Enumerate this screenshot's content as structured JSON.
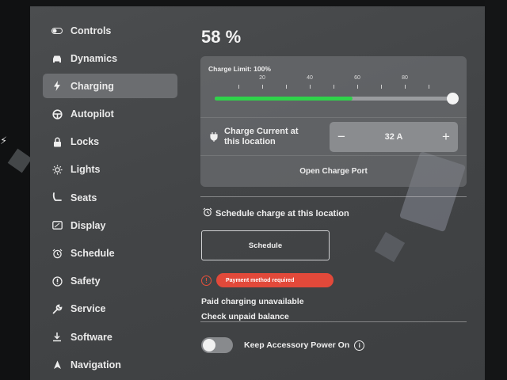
{
  "sidebar": {
    "items": [
      {
        "label": "Controls",
        "icon": "toggle-icon"
      },
      {
        "label": "Dynamics",
        "icon": "car-icon"
      },
      {
        "label": "Charging",
        "icon": "bolt-icon",
        "active": true
      },
      {
        "label": "Autopilot",
        "icon": "steering-wheel-icon"
      },
      {
        "label": "Locks",
        "icon": "lock-icon"
      },
      {
        "label": "Lights",
        "icon": "sun-icon"
      },
      {
        "label": "Seats",
        "icon": "seat-icon"
      },
      {
        "label": "Display",
        "icon": "display-icon"
      },
      {
        "label": "Schedule",
        "icon": "alarm-clock-icon"
      },
      {
        "label": "Safety",
        "icon": "info-circle-icon"
      },
      {
        "label": "Service",
        "icon": "wrench-icon"
      },
      {
        "label": "Software",
        "icon": "download-icon"
      },
      {
        "label": "Navigation",
        "icon": "navigation-arrow-icon"
      }
    ]
  },
  "charging": {
    "battery_percent": "58 %",
    "limit_label": "Charge Limit: 100%",
    "limit_value_percent": 100,
    "battery_level_fraction": 0.58,
    "tick_labels": [
      "20",
      "40",
      "60",
      "80"
    ],
    "current_label": "Charge Current at this location",
    "current_value": "32 A",
    "minus_symbol": "−",
    "plus_symbol": "+",
    "open_port_label": "Open Charge Port"
  },
  "schedule": {
    "title": "Schedule charge at this location",
    "button_label": "Schedule"
  },
  "payment": {
    "warning_symbol": "!",
    "badge_text": "Payment method required",
    "paid_unavailable": "Paid charging unavailable",
    "unpaid_link": "Check unpaid balance"
  },
  "accessory": {
    "label": "Keep Accessory Power On",
    "info_symbol": "i",
    "enabled": false
  },
  "colors": {
    "accent_green": "#2fd34a",
    "warning_red": "#e2493a"
  }
}
